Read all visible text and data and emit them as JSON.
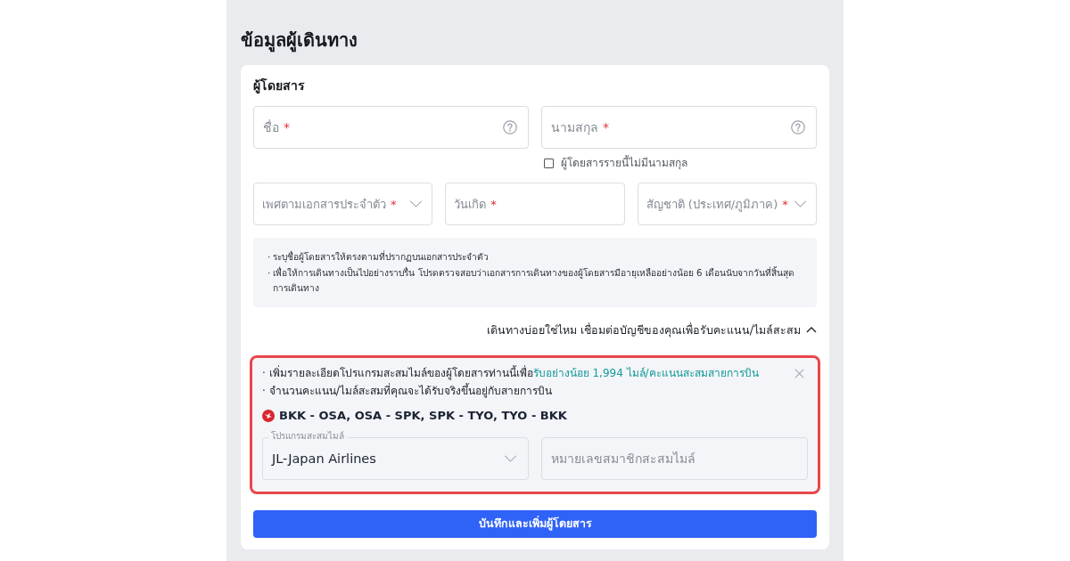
{
  "page": {
    "title": "ข้อมูลผู้เดินทาง"
  },
  "passenger": {
    "heading": "ผู้โดยสาร",
    "name_fields": [
      {
        "kind": "text",
        "label": "ชื่อ",
        "required_mark": "*",
        "help": true
      },
      {
        "kind": "text",
        "label": "นามสกุล",
        "required_mark": "*",
        "help": true
      }
    ],
    "no_surname": {
      "label": "ผู้โดยสารรายนี้ไม่มีนามสกุล",
      "checked": false
    },
    "detail_fields": [
      {
        "kind": "select",
        "label": "เพศตามเอกสารประจำตัว",
        "required_mark": "*"
      },
      {
        "kind": "text",
        "label": "วันเกิด",
        "required_mark": "*"
      },
      {
        "kind": "select",
        "label": "สัญชาติ (ประเทศ/ภูมิภาค)",
        "required_mark": "*"
      }
    ],
    "notes": [
      "· ระบุชื่อผู้โดยสารให้ตรงตามที่ปรากฏบนเอกสารประจำตัว",
      "· เพื่อให้การเดินทางเป็นไปอย่างราบรื่น โปรดตรวจสอบว่าเอกสารการเดินทางของผู้โดยสารมีอายุเหลืออย่างน้อย 6 เดือนนับจากวันที่สิ้นสุดการเดินทาง"
    ],
    "loyalty_toggle": {
      "label": "เดินทางบ่อยใช่ไหม เชื่อมต่อบัญชีของคุณเพื่อรับคะแนน/ไมล์สะสม",
      "expanded": true
    },
    "loyalty_panel": {
      "highlighted": true,
      "notes": [
        {
          "text": "· เพิ่มรายละเอียดโปรแกรมสะสมไมล์ของผู้โดยสารท่านนี้เพื่อ",
          "highlight": "รับอย่างน้อย 1,994 ไมล์/คะแนนสะสมสายการบิน"
        },
        {
          "text": "· จำนวนคะแนน/ไมล์สะสมที่คุณจะได้รับจริงขึ้นอยู่กับสายการบิน"
        }
      ],
      "route": "BKK - OSA, OSA - SPK, SPK - TYO, TYO - BKK",
      "fields": [
        {
          "kind": "select",
          "label": "โปรแกรมสะสมไมล์",
          "value": "JL-Japan Airlines"
        },
        {
          "kind": "text",
          "label": "หมายเลขสมาชิกสะสมไมล์"
        }
      ]
    },
    "submit": "บันทึกและเพิ่มผู้โดยสาร"
  }
}
